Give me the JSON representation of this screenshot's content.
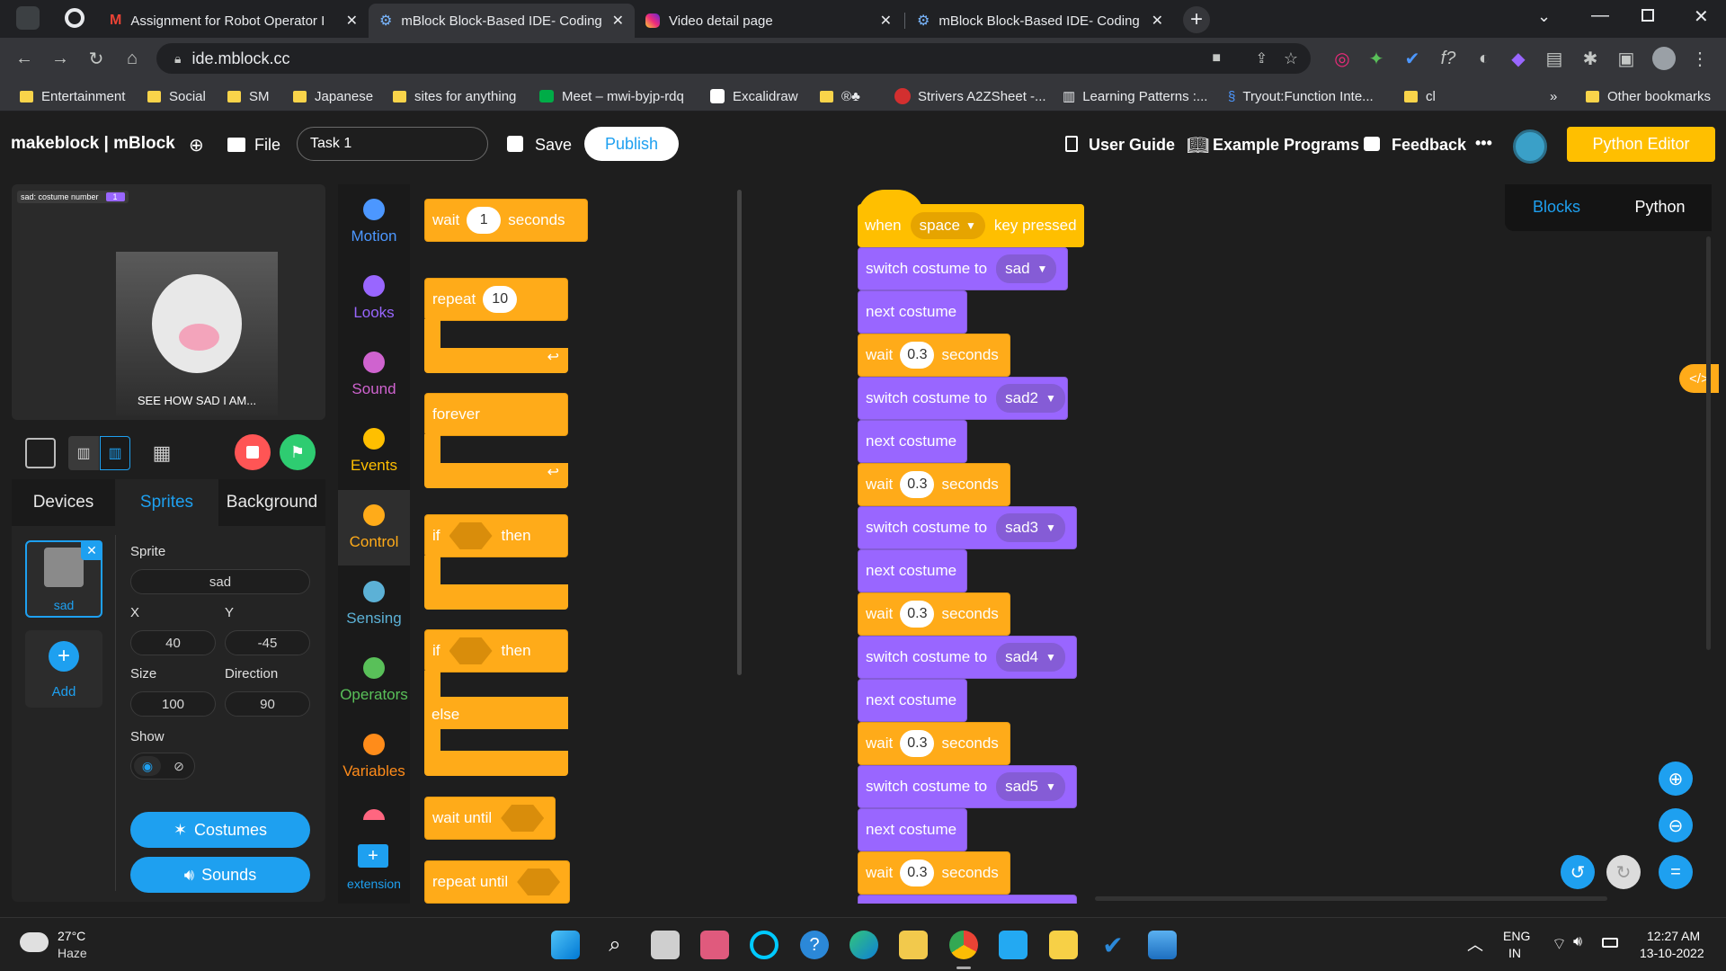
{
  "browser": {
    "tabs": [
      {
        "title": "Assignment for Robot Operator I",
        "icon": "gmail-icon"
      },
      {
        "title": "mBlock Block-Based IDE- Coding",
        "icon": "mblock-icon",
        "active": true
      },
      {
        "title": "Video detail page",
        "icon": "instagram-icon"
      },
      {
        "title": "mBlock Block-Based IDE- Coding",
        "icon": "mblock-icon"
      }
    ],
    "url": "ide.mblock.cc",
    "bookmarks": [
      "Entertainment",
      "Social",
      "SM",
      "Japanese",
      "sites for anything",
      "Meet – mwi-byjp-rdq",
      "Excalidraw",
      "®♣",
      "Strivers A2ZSheet -...",
      "Learning Patterns :...",
      "Tryout:Function Inte...",
      "cl"
    ],
    "more_bookmarks": "»",
    "other_bookmarks": "Other bookmarks"
  },
  "header": {
    "logo": "makeblock | mBlock",
    "file": "File",
    "project_name": "Task 1",
    "save": "Save",
    "publish": "Publish",
    "user_guide": "User Guide",
    "examples": "Example Programs",
    "feedback": "Feedback",
    "more": "•••",
    "python_editor": "Python Editor"
  },
  "stage": {
    "monitor_label": "sad: costume number",
    "monitor_value": "1",
    "caption": "SEE HOW SAD I AM..."
  },
  "sprite_panel": {
    "tabs": [
      "Devices",
      "Sprites",
      "Background"
    ],
    "sprite_thumb_label": "sad",
    "add_label": "Add",
    "sprite_label": "Sprite",
    "sprite_name": "sad",
    "x_label": "X",
    "x_value": "40",
    "y_label": "Y",
    "y_value": "-45",
    "size_label": "Size",
    "size_value": "100",
    "direction_label": "Direction",
    "direction_value": "90",
    "show_label": "Show",
    "costumes": "Costumes",
    "sounds": "Sounds"
  },
  "categories": [
    {
      "label": "Motion",
      "color": "#4c97ff"
    },
    {
      "label": "Looks",
      "color": "#9966ff"
    },
    {
      "label": "Sound",
      "color": "#cf63cf"
    },
    {
      "label": "Events",
      "color": "#ffbf00"
    },
    {
      "label": "Control",
      "color": "#ffab19"
    },
    {
      "label": "Sensing",
      "color": "#5cb1d6"
    },
    {
      "label": "Operators",
      "color": "#59c059"
    },
    {
      "label": "Variables",
      "color": "#ff8c1a"
    }
  ],
  "extension_label": "extension",
  "palette": {
    "wait_a": "wait",
    "wait_value": "1",
    "wait_b": "seconds",
    "repeat": "repeat",
    "repeat_value": "10",
    "forever": "forever",
    "if": "if",
    "then": "then",
    "if2": "if",
    "then2": "then",
    "else": "else",
    "wait_until": "wait until",
    "repeat_until": "repeat until"
  },
  "workspace": {
    "view_tabs": [
      "Blocks",
      "Python"
    ],
    "hat": {
      "when": "when",
      "key": "space",
      "pressed": "key pressed"
    },
    "script": [
      {
        "type": "switch",
        "text": "switch costume to",
        "arg": "sad"
      },
      {
        "type": "next",
        "text": "next costume"
      },
      {
        "type": "wait",
        "text": "wait",
        "arg": "0.3",
        "tail": "seconds"
      },
      {
        "type": "switch",
        "text": "switch costume to",
        "arg": "sad2"
      },
      {
        "type": "next",
        "text": "next costume"
      },
      {
        "type": "wait",
        "text": "wait",
        "arg": "0.3",
        "tail": "seconds"
      },
      {
        "type": "switch",
        "text": "switch costume to",
        "arg": "sad3"
      },
      {
        "type": "next",
        "text": "next costume"
      },
      {
        "type": "wait",
        "text": "wait",
        "arg": "0.3",
        "tail": "seconds"
      },
      {
        "type": "switch",
        "text": "switch costume to",
        "arg": "sad4"
      },
      {
        "type": "next",
        "text": "next costume"
      },
      {
        "type": "wait",
        "text": "wait",
        "arg": "0.3",
        "tail": "seconds"
      },
      {
        "type": "switch",
        "text": "switch costume to",
        "arg": "sad5"
      },
      {
        "type": "next",
        "text": "next costume"
      },
      {
        "type": "wait",
        "text": "wait",
        "arg": "0.3",
        "tail": "seconds"
      }
    ],
    "code_toggle": "</>"
  },
  "taskbar": {
    "weather_temp": "27°C",
    "weather_desc": "Haze",
    "lang_top": "ENG",
    "lang_bottom": "IN",
    "time": "12:27 AM",
    "date": "13-10-2022"
  }
}
